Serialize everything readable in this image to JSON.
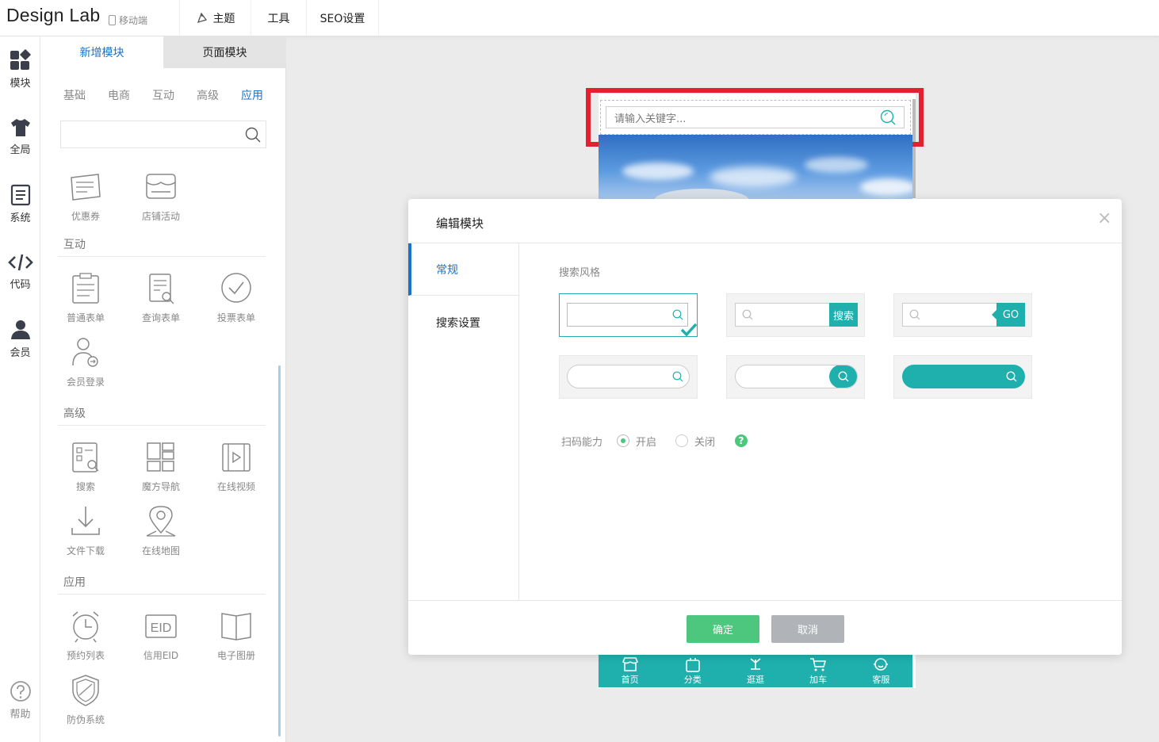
{
  "topbar": {
    "brand": "Design Lab",
    "mobile_label": "移动端",
    "nav": [
      "主题",
      "工具",
      "SEO设置"
    ]
  },
  "rail": {
    "items": [
      "模块",
      "全局",
      "系统",
      "代码",
      "会员"
    ],
    "help": "帮助"
  },
  "panel": {
    "tabs": [
      "新增模块",
      "页面模块"
    ],
    "categories": [
      "基础",
      "电商",
      "互动",
      "高级",
      "应用"
    ],
    "active_category": "应用",
    "top_items": [
      "优惠券",
      "店铺活动"
    ],
    "sections": [
      {
        "title": "互动",
        "items": [
          "普通表单",
          "查询表单",
          "投票表单",
          "会员登录"
        ]
      },
      {
        "title": "高级",
        "items": [
          "搜索",
          "魔方导航",
          "在线视频",
          "文件下载",
          "在线地图"
        ]
      },
      {
        "title": "应用",
        "items": [
          "预约列表",
          "信用EID",
          "电子图册",
          "防伪系统"
        ]
      }
    ],
    "eid_glyph": "EID"
  },
  "canvas": {
    "search_placeholder": "请输入关键字...",
    "bottom_nav": [
      "首页",
      "分类",
      "逛逛",
      "加车",
      "客服"
    ]
  },
  "modal": {
    "title": "编辑模块",
    "close": "×",
    "tabs": [
      "常规",
      "搜索设置"
    ],
    "style_label": "搜索风格",
    "style_btn_search": "搜索",
    "style_btn_go": "GO",
    "scan_label": "扫码能力",
    "scan_on": "开启",
    "scan_off": "关闭",
    "help_glyph": "?",
    "ok": "确定",
    "cancel": "取消"
  },
  "colors": {
    "accent": "#1a73c8",
    "teal": "#1fb0ae",
    "ok": "#4cc77d",
    "cancel": "#b0b4b8",
    "highlight": "#e5202e"
  }
}
